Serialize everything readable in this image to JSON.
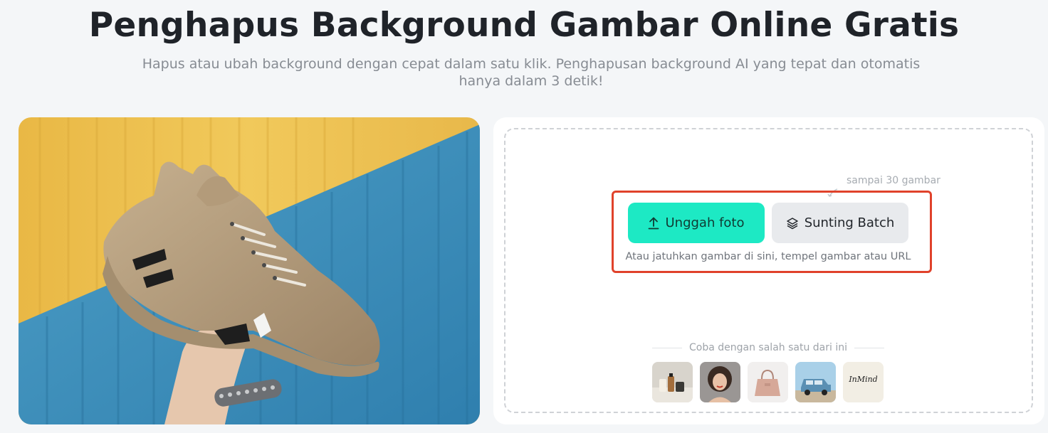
{
  "header": {
    "title": "Penghapus Background Gambar Online Gratis",
    "subtitle": "Hapus atau ubah background dengan cepat dalam satu klik. Penghapusan background AI yang tepat dan otomatis hanya dalam 3 detik!"
  },
  "upload": {
    "batch_note": "sampai 30 gambar",
    "upload_label": "Unggah foto",
    "batch_label": "Sunting Batch",
    "drop_hint": "Atau jatuhkan gambar di sini, tempel gambar atau URL",
    "highlight_color": "#e0422b",
    "upload_color": "#1de9c4"
  },
  "samples": {
    "label": "Coba dengan salah satu dari ini",
    "items": [
      {
        "name": "cosmetics-bottles"
      },
      {
        "name": "woman-portrait"
      },
      {
        "name": "pink-handbag"
      },
      {
        "name": "blue-suv-car"
      },
      {
        "name": "signature",
        "text": "InMind"
      }
    ]
  },
  "icons": {
    "upload": "upload-arrow-icon",
    "batch": "layers-icon"
  }
}
